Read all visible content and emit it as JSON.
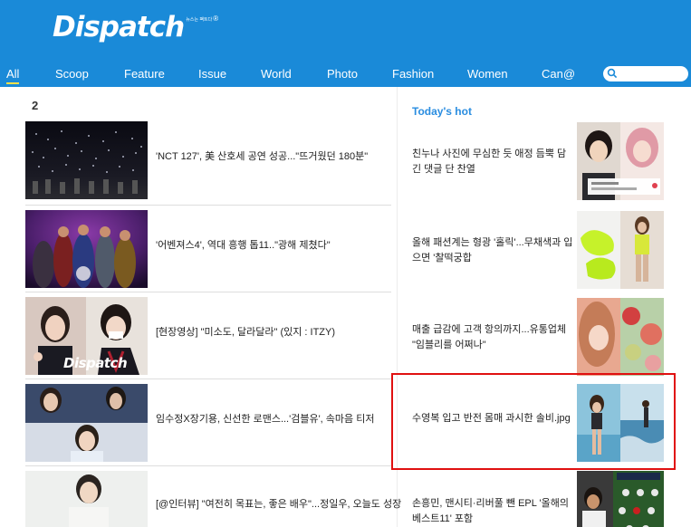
{
  "header": {
    "logo": "Dispatch",
    "logo_tagline": "뉴스는 팩트다",
    "logo_reg": "®"
  },
  "nav": {
    "items": [
      "All",
      "Scoop",
      "Feature",
      "Issue",
      "World",
      "Photo",
      "Fashion",
      "Women",
      "Can@"
    ],
    "active_index": 0
  },
  "search": {
    "placeholder": ""
  },
  "main": {
    "rank_number": "2",
    "left_articles": [
      {
        "title": "'NCT 127', 美 산호세 공연 성공...\"뜨거웠던 180분\""
      },
      {
        "title": "'어벤져스4', 역대 흥행 톱11..\"광해 제쳤다\""
      },
      {
        "title": "[현장영상] \"미소도, 달라달라\" (있지 : ITZY)",
        "thumb_watermark": "Dispatch"
      },
      {
        "title": "임수정X장기용, 신선한 로맨스...'검블유', 속마음 티저"
      },
      {
        "title": "[@인터뷰] \"여전히 목표는, 좋은 배우\"...정일우, 오늘도 성장"
      }
    ]
  },
  "sidebar": {
    "heading": "Today's hot",
    "articles": [
      {
        "title": "친누나 사진에 무심한 듯 애정 듬뿍 담긴 댓글 단 찬열"
      },
      {
        "title": "올해 패션계는 형광 '홀릭'...무채색과 입으면 '찰떡궁합"
      },
      {
        "title": "매출 급감에 고객 항의까지...유통업체 \"임블리를 어쩌나\""
      },
      {
        "title": "수영복 입고 반전 몸매 과시한 솔비.jpg"
      },
      {
        "title": "손흥민, 맨시티·리버풀 뺀 EPL '올해의 베스트11' 포함"
      }
    ]
  },
  "colors": {
    "header_bg": "#1a8ad8",
    "accent": "#2a8de0",
    "active_underline": "#ffe04a",
    "highlight": "#e01010"
  }
}
